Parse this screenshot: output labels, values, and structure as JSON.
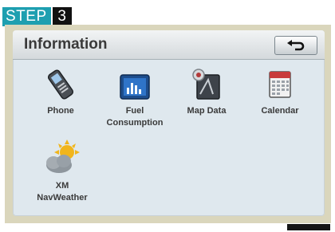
{
  "step": {
    "label": "STEP",
    "number": "3"
  },
  "header": {
    "title": "Information",
    "back_icon": "return-arrow-icon"
  },
  "menu": [
    {
      "label": "Phone",
      "icon": "phone-icon"
    },
    {
      "label": "Fuel\nConsumption",
      "icon": "bar-chart-icon"
    },
    {
      "label": "Map Data",
      "icon": "map-data-icon"
    },
    {
      "label": "Calendar",
      "icon": "calendar-icon"
    },
    {
      "label": "XM\nNavWeather",
      "icon": "weather-icon"
    }
  ],
  "colors": {
    "step_accent": "#1e9fb0",
    "screen_bg": "#dfe8ee",
    "frame_bg": "#dad6bc"
  }
}
